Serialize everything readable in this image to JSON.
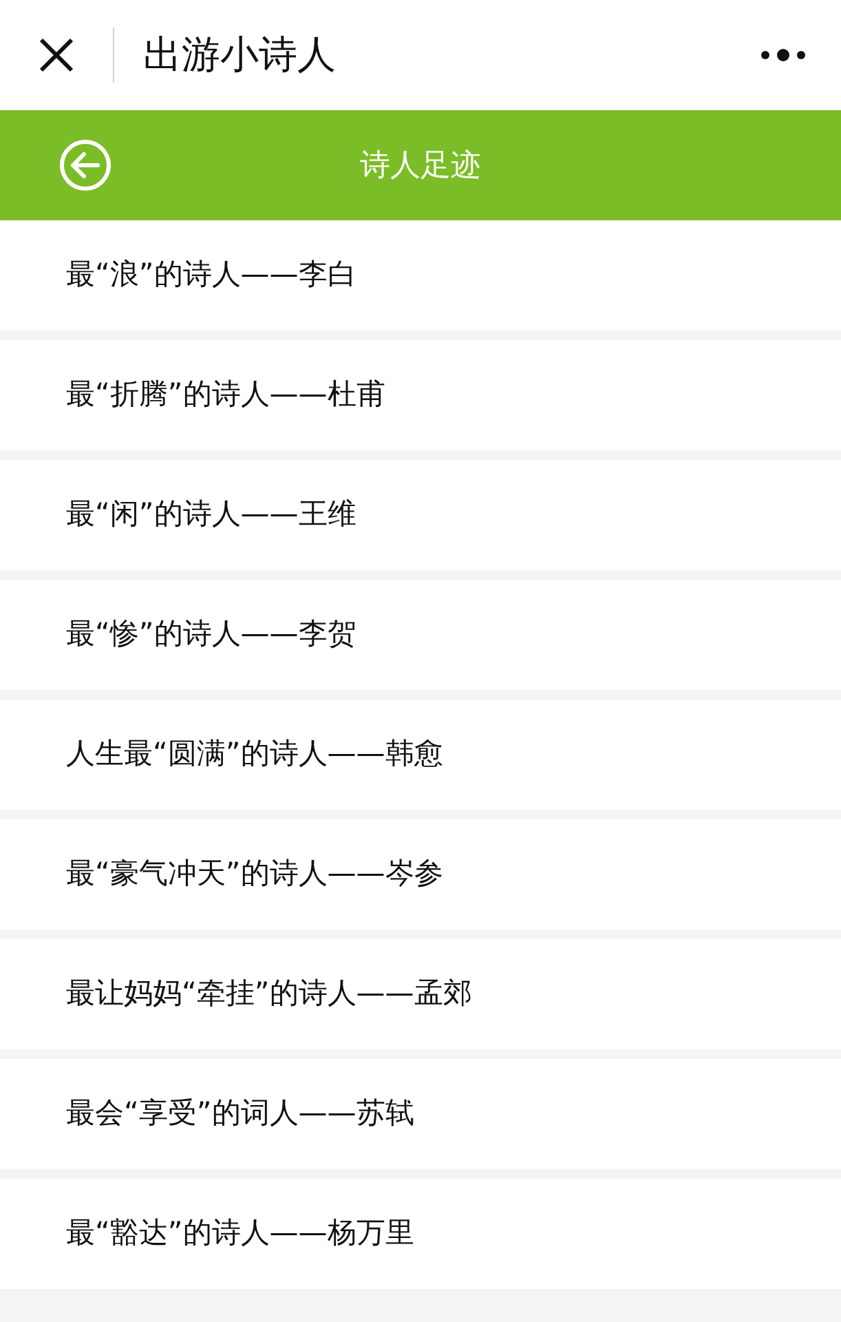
{
  "window": {
    "title": "出游小诗人"
  },
  "header": {
    "title": "诗人足迹"
  },
  "items": [
    {
      "text": "最“浪”的诗人——李白"
    },
    {
      "text": "最“折腾”的诗人——杜甫"
    },
    {
      "text": "最“闲”的诗人——王维"
    },
    {
      "text": "最“惨”的诗人——李贺"
    },
    {
      "text": "人生最“圆满”的诗人——韩愈"
    },
    {
      "text": "最“豪气冲天”的诗人——岑参"
    },
    {
      "text": "最让妈妈“牵挂”的诗人——孟郊"
    },
    {
      "text": "最会“享受”的词人——苏轼"
    },
    {
      "text": "最“豁达”的诗人——杨万里"
    }
  ]
}
